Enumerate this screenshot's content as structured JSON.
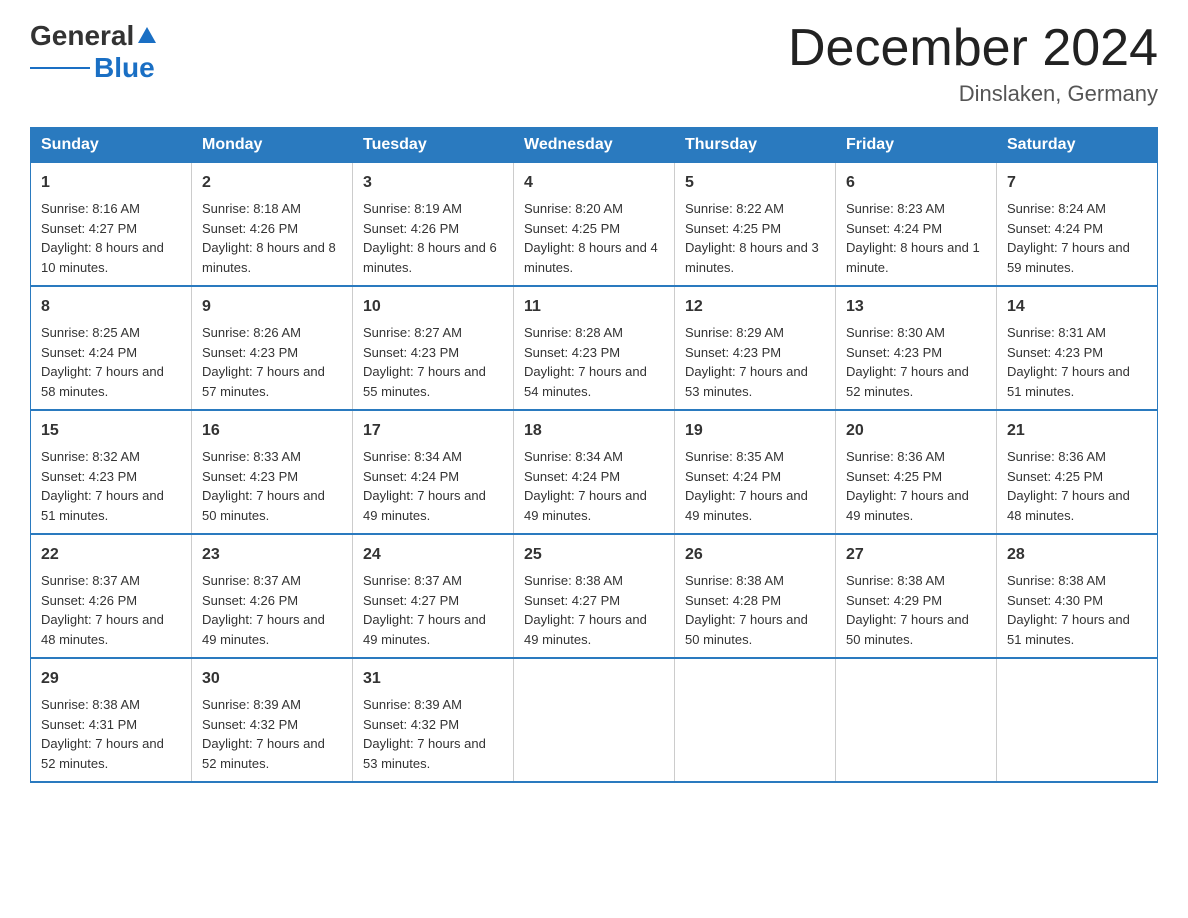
{
  "logo": {
    "general": "General",
    "blue": "Blue"
  },
  "title": "December 2024",
  "subtitle": "Dinslaken, Germany",
  "days_of_week": [
    "Sunday",
    "Monday",
    "Tuesday",
    "Wednesday",
    "Thursday",
    "Friday",
    "Saturday"
  ],
  "weeks": [
    [
      {
        "day": "1",
        "sunrise": "8:16 AM",
        "sunset": "4:27 PM",
        "daylight": "8 hours and 10 minutes."
      },
      {
        "day": "2",
        "sunrise": "8:18 AM",
        "sunset": "4:26 PM",
        "daylight": "8 hours and 8 minutes."
      },
      {
        "day": "3",
        "sunrise": "8:19 AM",
        "sunset": "4:26 PM",
        "daylight": "8 hours and 6 minutes."
      },
      {
        "day": "4",
        "sunrise": "8:20 AM",
        "sunset": "4:25 PM",
        "daylight": "8 hours and 4 minutes."
      },
      {
        "day": "5",
        "sunrise": "8:22 AM",
        "sunset": "4:25 PM",
        "daylight": "8 hours and 3 minutes."
      },
      {
        "day": "6",
        "sunrise": "8:23 AM",
        "sunset": "4:24 PM",
        "daylight": "8 hours and 1 minute."
      },
      {
        "day": "7",
        "sunrise": "8:24 AM",
        "sunset": "4:24 PM",
        "daylight": "7 hours and 59 minutes."
      }
    ],
    [
      {
        "day": "8",
        "sunrise": "8:25 AM",
        "sunset": "4:24 PM",
        "daylight": "7 hours and 58 minutes."
      },
      {
        "day": "9",
        "sunrise": "8:26 AM",
        "sunset": "4:23 PM",
        "daylight": "7 hours and 57 minutes."
      },
      {
        "day": "10",
        "sunrise": "8:27 AM",
        "sunset": "4:23 PM",
        "daylight": "7 hours and 55 minutes."
      },
      {
        "day": "11",
        "sunrise": "8:28 AM",
        "sunset": "4:23 PM",
        "daylight": "7 hours and 54 minutes."
      },
      {
        "day": "12",
        "sunrise": "8:29 AM",
        "sunset": "4:23 PM",
        "daylight": "7 hours and 53 minutes."
      },
      {
        "day": "13",
        "sunrise": "8:30 AM",
        "sunset": "4:23 PM",
        "daylight": "7 hours and 52 minutes."
      },
      {
        "day": "14",
        "sunrise": "8:31 AM",
        "sunset": "4:23 PM",
        "daylight": "7 hours and 51 minutes."
      }
    ],
    [
      {
        "day": "15",
        "sunrise": "8:32 AM",
        "sunset": "4:23 PM",
        "daylight": "7 hours and 51 minutes."
      },
      {
        "day": "16",
        "sunrise": "8:33 AM",
        "sunset": "4:23 PM",
        "daylight": "7 hours and 50 minutes."
      },
      {
        "day": "17",
        "sunrise": "8:34 AM",
        "sunset": "4:24 PM",
        "daylight": "7 hours and 49 minutes."
      },
      {
        "day": "18",
        "sunrise": "8:34 AM",
        "sunset": "4:24 PM",
        "daylight": "7 hours and 49 minutes."
      },
      {
        "day": "19",
        "sunrise": "8:35 AM",
        "sunset": "4:24 PM",
        "daylight": "7 hours and 49 minutes."
      },
      {
        "day": "20",
        "sunrise": "8:36 AM",
        "sunset": "4:25 PM",
        "daylight": "7 hours and 49 minutes."
      },
      {
        "day": "21",
        "sunrise": "8:36 AM",
        "sunset": "4:25 PM",
        "daylight": "7 hours and 48 minutes."
      }
    ],
    [
      {
        "day": "22",
        "sunrise": "8:37 AM",
        "sunset": "4:26 PM",
        "daylight": "7 hours and 48 minutes."
      },
      {
        "day": "23",
        "sunrise": "8:37 AM",
        "sunset": "4:26 PM",
        "daylight": "7 hours and 49 minutes."
      },
      {
        "day": "24",
        "sunrise": "8:37 AM",
        "sunset": "4:27 PM",
        "daylight": "7 hours and 49 minutes."
      },
      {
        "day": "25",
        "sunrise": "8:38 AM",
        "sunset": "4:27 PM",
        "daylight": "7 hours and 49 minutes."
      },
      {
        "day": "26",
        "sunrise": "8:38 AM",
        "sunset": "4:28 PM",
        "daylight": "7 hours and 50 minutes."
      },
      {
        "day": "27",
        "sunrise": "8:38 AM",
        "sunset": "4:29 PM",
        "daylight": "7 hours and 50 minutes."
      },
      {
        "day": "28",
        "sunrise": "8:38 AM",
        "sunset": "4:30 PM",
        "daylight": "7 hours and 51 minutes."
      }
    ],
    [
      {
        "day": "29",
        "sunrise": "8:38 AM",
        "sunset": "4:31 PM",
        "daylight": "7 hours and 52 minutes."
      },
      {
        "day": "30",
        "sunrise": "8:39 AM",
        "sunset": "4:32 PM",
        "daylight": "7 hours and 52 minutes."
      },
      {
        "day": "31",
        "sunrise": "8:39 AM",
        "sunset": "4:32 PM",
        "daylight": "7 hours and 53 minutes."
      },
      {
        "day": "",
        "sunrise": "",
        "sunset": "",
        "daylight": ""
      },
      {
        "day": "",
        "sunrise": "",
        "sunset": "",
        "daylight": ""
      },
      {
        "day": "",
        "sunrise": "",
        "sunset": "",
        "daylight": ""
      },
      {
        "day": "",
        "sunrise": "",
        "sunset": "",
        "daylight": ""
      }
    ]
  ],
  "labels": {
    "sunrise": "Sunrise:",
    "sunset": "Sunset:",
    "daylight": "Daylight:"
  }
}
